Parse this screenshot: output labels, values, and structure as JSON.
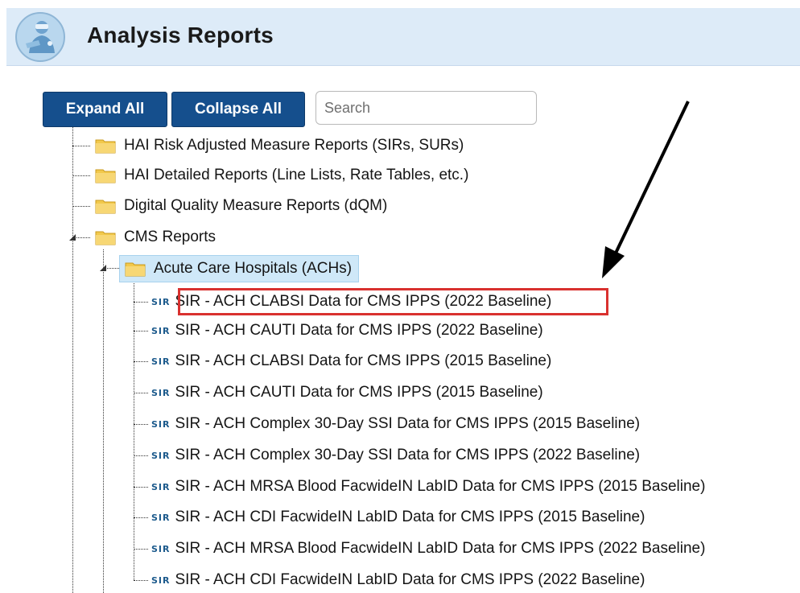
{
  "header": {
    "title": "Analysis Reports",
    "logo_icon": "medical-staff-logo-icon"
  },
  "toolbar": {
    "expand_label": "Expand All",
    "collapse_label": "Collapse All",
    "search_placeholder": "Search"
  },
  "tree": {
    "folders": [
      {
        "label": "HAI Risk Adjusted Measure Reports (SIRs, SURs)"
      },
      {
        "label": "HAI Detailed Reports (Line Lists, Rate Tables, etc.)"
      },
      {
        "label": "Digital Quality Measure Reports (dQM)"
      },
      {
        "label": "CMS Reports"
      },
      {
        "label": "Acute Care Hospitals (ACHs)"
      }
    ],
    "report_icon_text": "SIR",
    "reports": [
      {
        "label": "SIR - ACH CLABSI Data for CMS IPPS (2022 Baseline)"
      },
      {
        "label": "SIR - ACH CAUTI Data for CMS IPPS (2022 Baseline)"
      },
      {
        "label": "SIR - ACH CLABSI Data for CMS IPPS (2015 Baseline)"
      },
      {
        "label": "SIR - ACH CAUTI Data for CMS IPPS (2015 Baseline)"
      },
      {
        "label": "SIR - ACH Complex 30-Day SSI Data for CMS IPPS (2015 Baseline)"
      },
      {
        "label": "SIR - ACH Complex 30-Day SSI Data for CMS IPPS (2022 Baseline)"
      },
      {
        "label": "SIR - ACH MRSA Blood FacwideIN LabID Data for CMS IPPS (2015 Baseline)"
      },
      {
        "label": "SIR - ACH CDI FacwideIN LabID Data for CMS IPPS (2015 Baseline)"
      },
      {
        "label": "SIR - ACH MRSA Blood FacwideIN LabID Data for CMS IPPS (2022 Baseline)"
      },
      {
        "label": "SIR - ACH CDI FacwideIN LabID Data for CMS IPPS (2022 Baseline)"
      }
    ]
  },
  "colors": {
    "button_bg": "#154f8d",
    "header_bg": "#ddebf8",
    "highlight": "#d9312f",
    "folder": "#f2c94c"
  }
}
